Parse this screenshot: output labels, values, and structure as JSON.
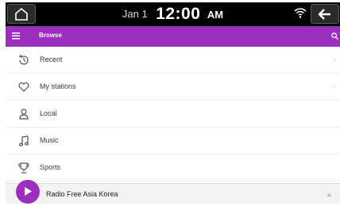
{
  "status_bar": {
    "date": "Jan 1",
    "time": "12:00",
    "ampm": "AM"
  },
  "header": {
    "title": "Browse"
  },
  "list": {
    "items": [
      {
        "label": "Recent",
        "icon": "clock-icon"
      },
      {
        "label": "My stations",
        "icon": "heart-icon"
      },
      {
        "label": "Local",
        "icon": "location-person-icon"
      },
      {
        "label": "Music",
        "icon": "music-note-icon"
      },
      {
        "label": "Sports",
        "icon": "trophy-icon"
      }
    ]
  },
  "now_playing": {
    "title": "Radio Free Asia Korea"
  },
  "colors": {
    "accent": "#9d2fbf",
    "status_bar": "#000000",
    "background": "#ffffff"
  }
}
